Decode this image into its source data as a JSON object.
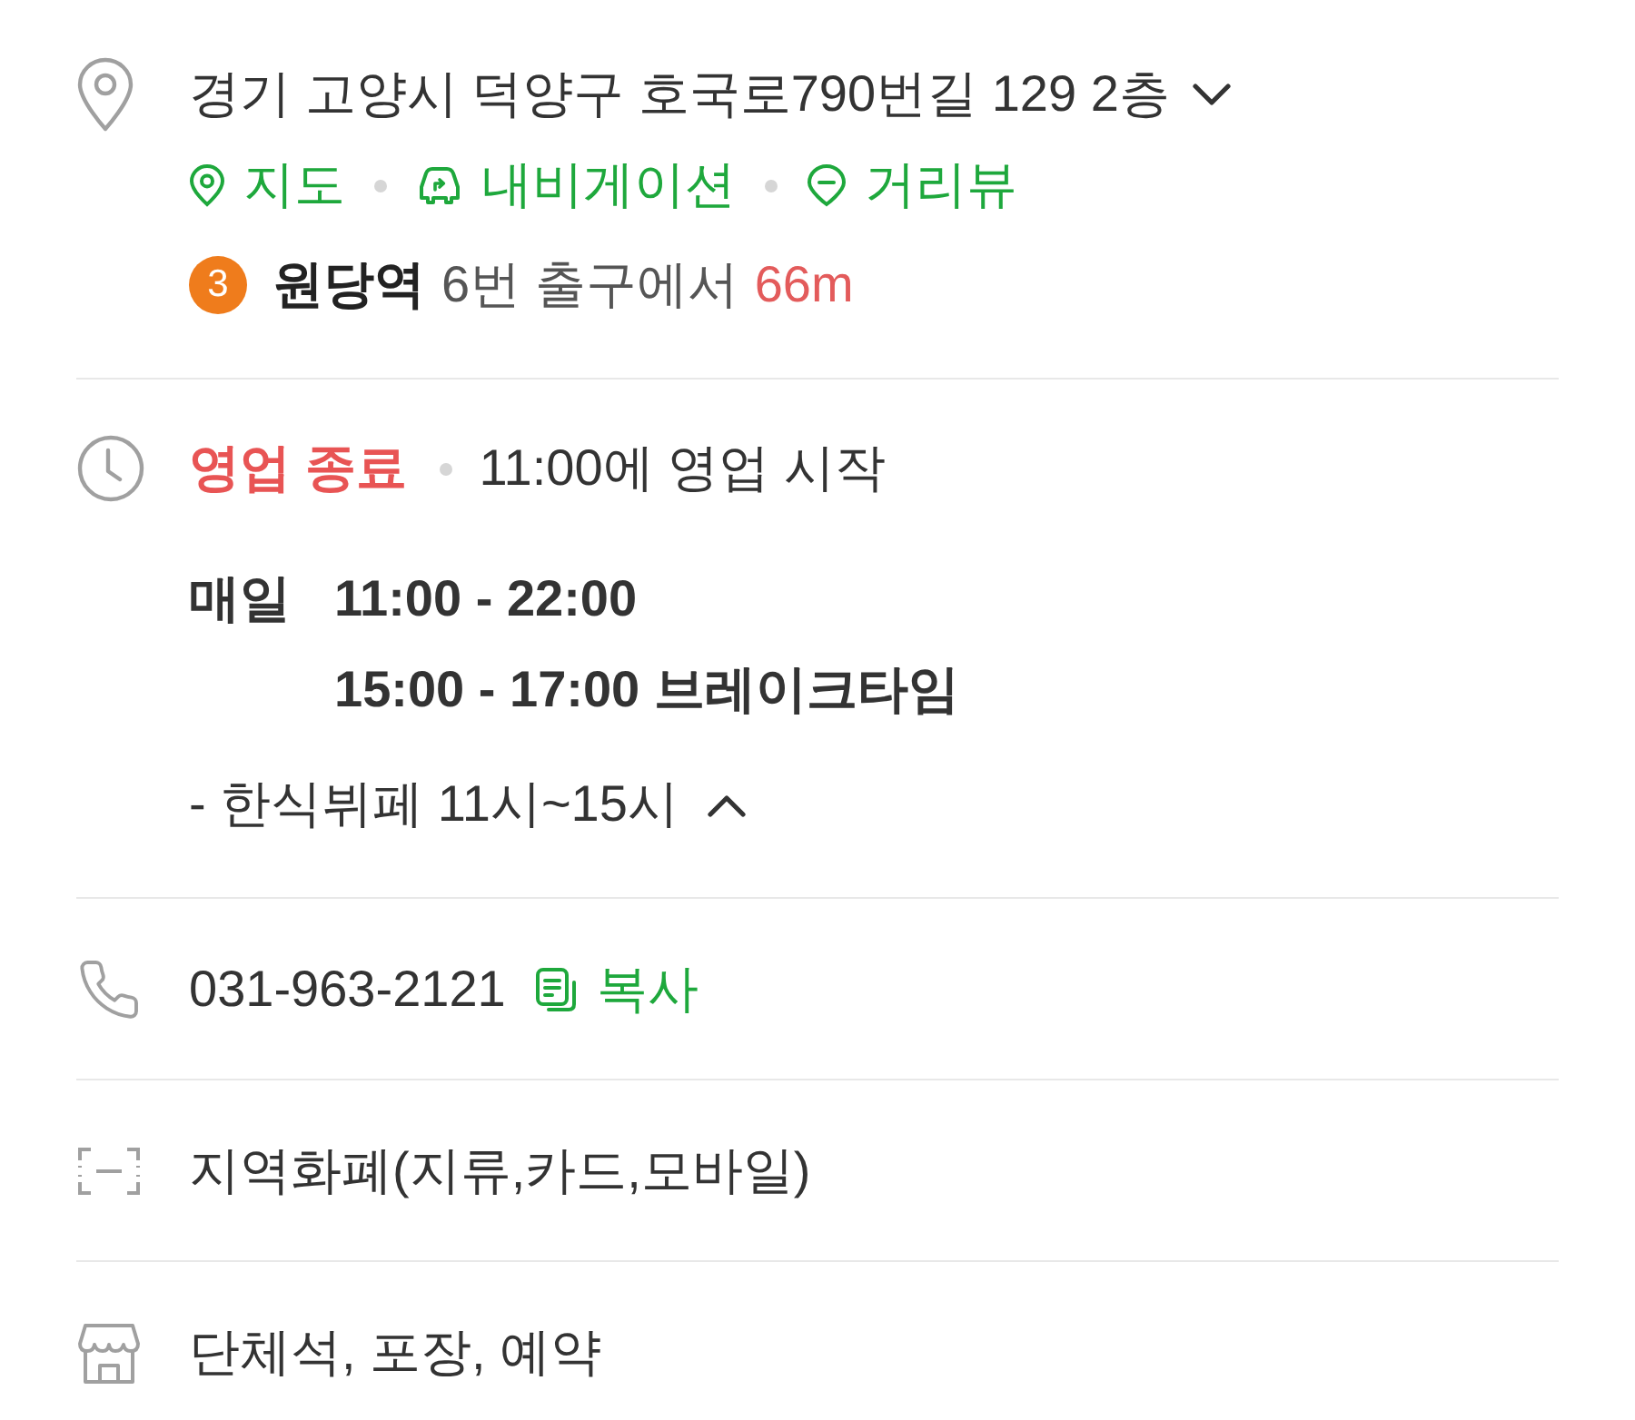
{
  "address": {
    "text": "경기 고양시 덕양구 호국로790번길 129 2층",
    "expanded": false
  },
  "map_links": [
    {
      "kind": "map",
      "label": "지도"
    },
    {
      "kind": "navigation",
      "label": "내비게이션"
    },
    {
      "kind": "street_view",
      "label": "거리뷰"
    }
  ],
  "subway": {
    "line": {
      "label": "3",
      "color": "#ef7c1c"
    },
    "station": "원당역",
    "exit": "6번 출구에서",
    "distance": "66m"
  },
  "hours": {
    "open": false,
    "status": "영업 종료",
    "next_opening": "11:00에 영업 시작",
    "schedule": {
      "day": "매일",
      "times": [
        "11:00 - 22:00",
        "15:00 - 17:00 브레이크타임"
      ]
    },
    "note": "- 한식뷔페 11시~15시",
    "expanded": true
  },
  "phone": {
    "number": "031-963-2121",
    "copy_label": "복사"
  },
  "payment": {
    "text": "지역화폐(지류,카드,모바일)"
  },
  "facilities": {
    "text": "단체석, 포장, 예약"
  }
}
